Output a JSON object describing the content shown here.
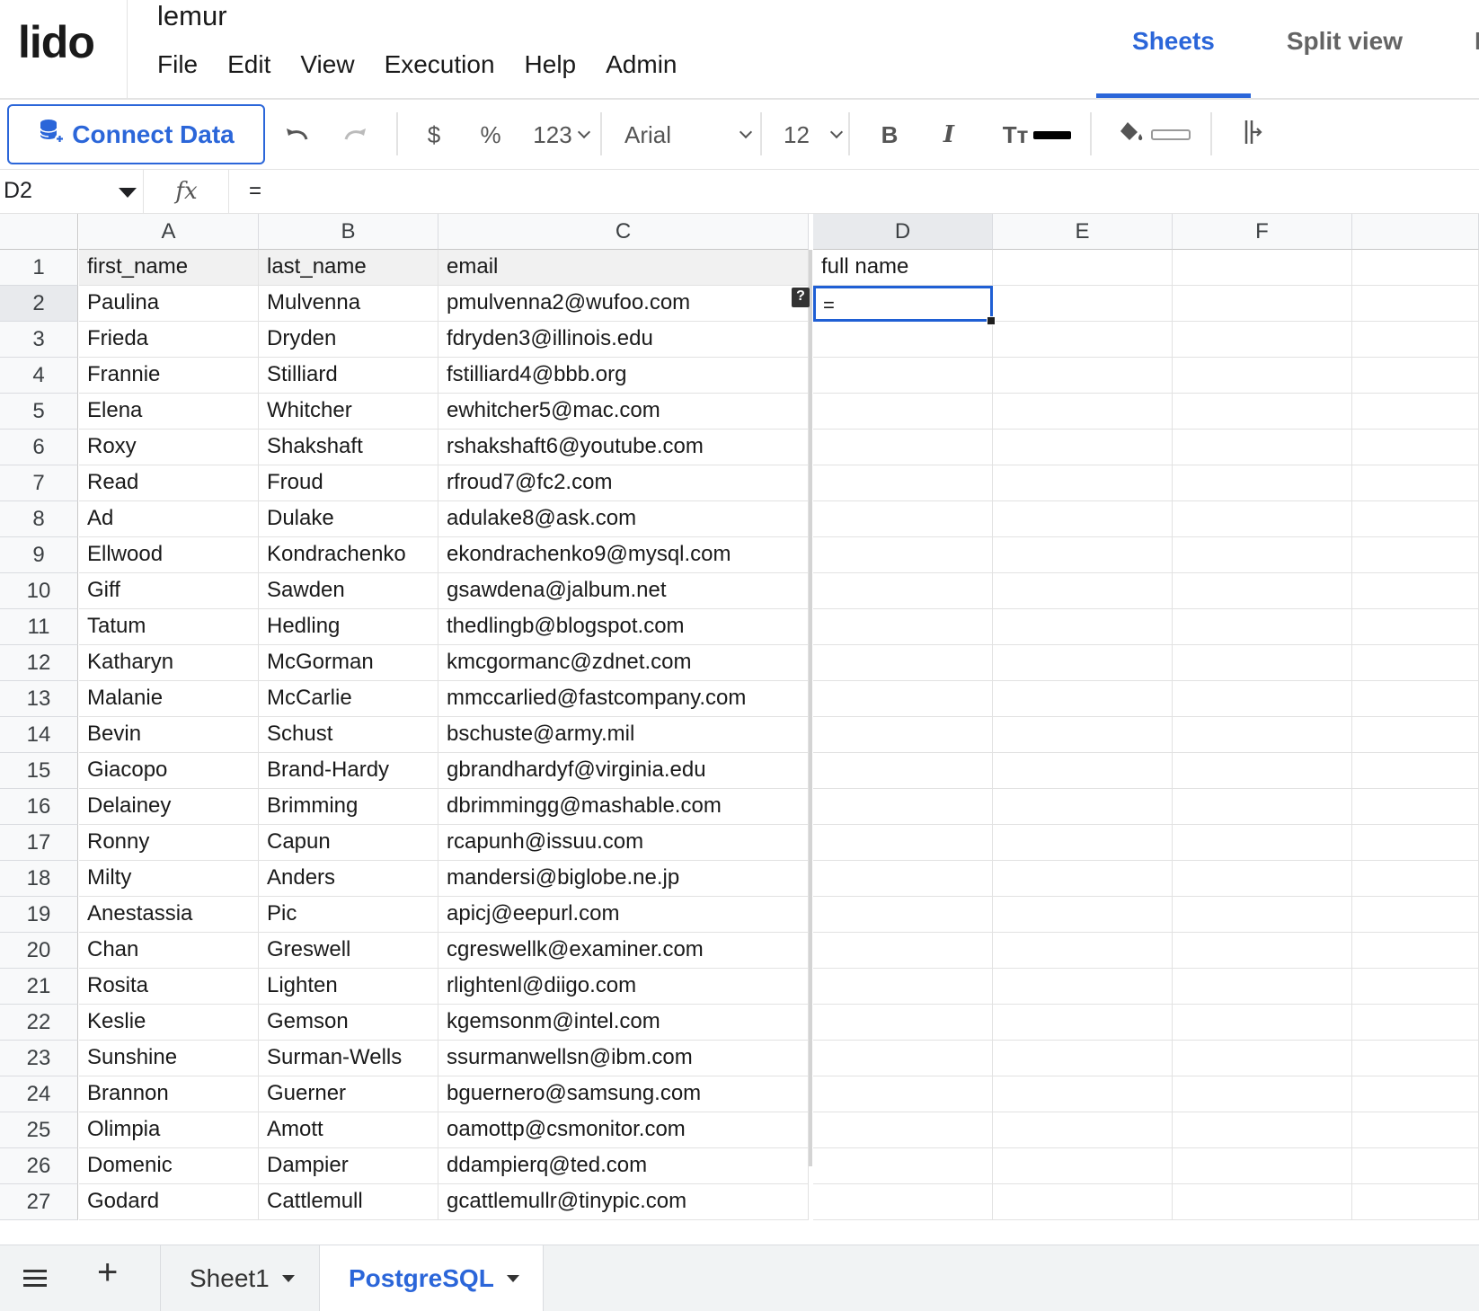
{
  "app": {
    "logo": "lido",
    "doc_title": "lemur",
    "menu": [
      "File",
      "Edit",
      "View",
      "Execution",
      "Help",
      "Admin"
    ],
    "view_tabs": [
      {
        "label": "Sheets",
        "active": true
      },
      {
        "label": "Split view",
        "active": false
      },
      {
        "label": "Da",
        "active": false
      }
    ],
    "accent_color": "#2b66d9"
  },
  "toolbar": {
    "connect_label": "Connect Data",
    "currency": "$",
    "percent": "%",
    "number_format": "123",
    "font": "Arial",
    "font_size": "12",
    "bold": "B",
    "italic": "I",
    "text_size_icon": "Tт",
    "text_color": "#000000",
    "fill_color": "#ffffff"
  },
  "formula_bar": {
    "cell_ref": "D2",
    "fx": "fx",
    "formula": "="
  },
  "grid": {
    "columns": [
      "A",
      "B",
      "C",
      "D",
      "E",
      "F"
    ],
    "selected_column": "D",
    "selected_row": "2",
    "active_cell_value": "=",
    "help_badge": "?",
    "header_row": [
      "first_name",
      "last_name",
      "email",
      "full name"
    ],
    "rows": [
      [
        "Paulina",
        "Mulvenna",
        "pmulvenna2@wufoo.com"
      ],
      [
        "Frieda",
        "Dryden",
        "fdryden3@illinois.edu"
      ],
      [
        "Frannie",
        "Stilliard",
        "fstilliard4@bbb.org"
      ],
      [
        "Elena",
        "Whitcher",
        "ewhitcher5@mac.com"
      ],
      [
        "Roxy",
        "Shakshaft",
        "rshakshaft6@youtube.com"
      ],
      [
        "Read",
        "Froud",
        "rfroud7@fc2.com"
      ],
      [
        "Ad",
        "Dulake",
        "adulake8@ask.com"
      ],
      [
        "Ellwood",
        "Kondrachenko",
        "ekondrachenko9@mysql.com"
      ],
      [
        "Giff",
        "Sawden",
        "gsawdena@jalbum.net"
      ],
      [
        "Tatum",
        "Hedling",
        "thedlingb@blogspot.com"
      ],
      [
        "Katharyn",
        "McGorman",
        "kmcgormanc@zdnet.com"
      ],
      [
        "Malanie",
        "McCarlie",
        "mmccarlied@fastcompany.com"
      ],
      [
        "Bevin",
        "Schust",
        "bschuste@army.mil"
      ],
      [
        "Giacopo",
        "Brand-Hardy",
        "gbrandhardyf@virginia.edu"
      ],
      [
        "Delainey",
        "Brimming",
        "dbrimmingg@mashable.com"
      ],
      [
        "Ronny",
        "Capun",
        "rcapunh@issuu.com"
      ],
      [
        "Milty",
        "Anders",
        "mandersi@biglobe.ne.jp"
      ],
      [
        "Anestassia",
        "Pic",
        "apicj@eepurl.com"
      ],
      [
        "Chan",
        "Greswell",
        "cgreswellk@examiner.com"
      ],
      [
        "Rosita",
        "Lighten",
        "rlightenl@diigo.com"
      ],
      [
        "Keslie",
        "Gemson",
        "kgemsonm@intel.com"
      ],
      [
        "Sunshine",
        "Surman-Wells",
        "ssurmanwellsn@ibm.com"
      ],
      [
        "Brannon",
        "Guerner",
        "bguernero@samsung.com"
      ],
      [
        "Olimpia",
        "Amott",
        "oamottp@csmonitor.com"
      ],
      [
        "Domenic",
        "Dampier",
        "ddampierq@ted.com"
      ],
      [
        "Godard",
        "Cattlemull",
        "gcattlemullr@tinypic.com"
      ]
    ]
  },
  "sheets": [
    {
      "label": "Sheet1",
      "active": false
    },
    {
      "label": "PostgreSQL",
      "active": true
    }
  ]
}
